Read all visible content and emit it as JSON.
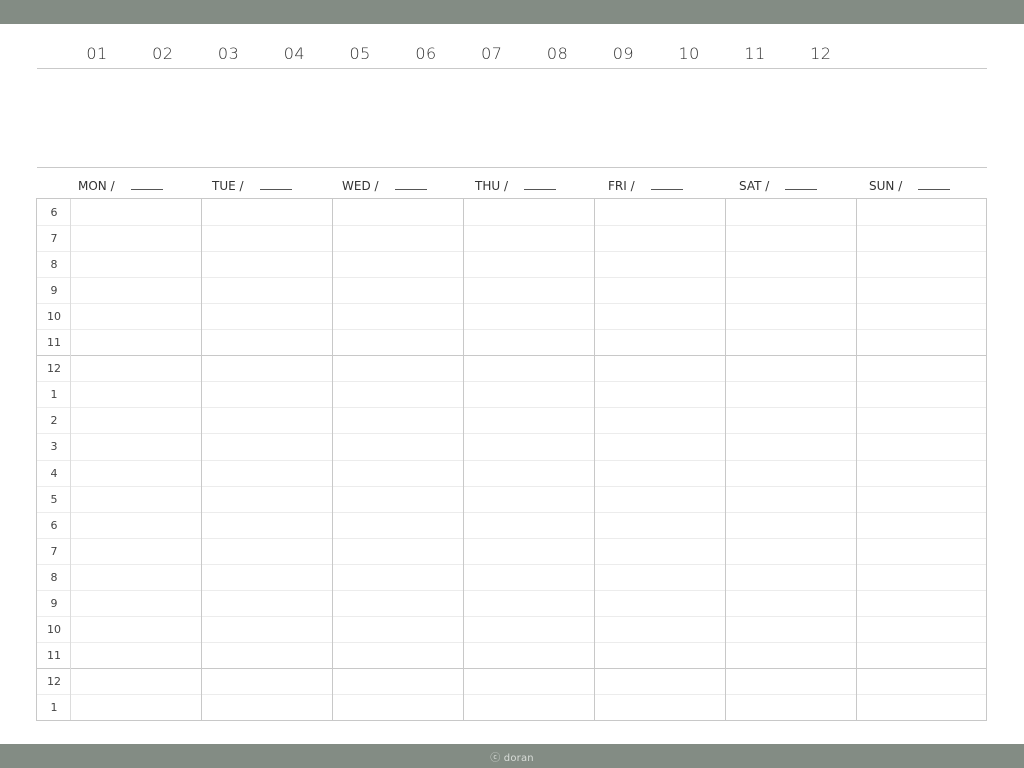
{
  "months": [
    "01",
    "02",
    "03",
    "04",
    "05",
    "06",
    "07",
    "08",
    "09",
    "10",
    "11",
    "12"
  ],
  "days": [
    {
      "label": "MON /",
      "blank": ""
    },
    {
      "label": "TUE /",
      "blank": ""
    },
    {
      "label": "WED /",
      "blank": ""
    },
    {
      "label": "THU /",
      "blank": ""
    },
    {
      "label": "FRI /",
      "blank": ""
    },
    {
      "label": "SAT /",
      "blank": ""
    },
    {
      "label": "SUN /",
      "blank": ""
    }
  ],
  "hours": [
    "6",
    "7",
    "8",
    "9",
    "10",
    "11",
    "12",
    "1",
    "2",
    "3",
    "4",
    "5",
    "6",
    "7",
    "8",
    "9",
    "10",
    "11",
    "12",
    "1"
  ],
  "footer": {
    "copyright": "ⓒ doran"
  },
  "colors": {
    "bar": "#838c84",
    "grid": "#c8c8c8"
  }
}
